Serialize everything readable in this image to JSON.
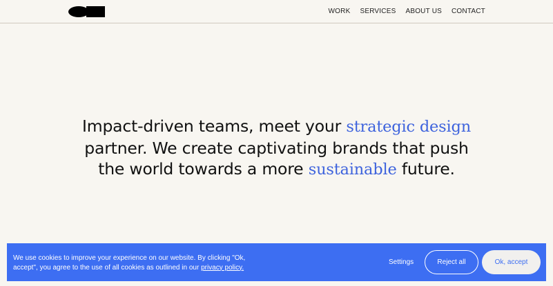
{
  "header": {
    "nav": [
      {
        "label": "WORK"
      },
      {
        "label": "SERVICES"
      },
      {
        "label": "ABOUT US"
      },
      {
        "label": "CONTACT"
      }
    ]
  },
  "hero": {
    "line1_pre": "Impact-driven teams, meet your ",
    "line1_accent": "strategic design",
    "line2": "partner. We create captivating brands that push",
    "line3_pre": "the world towards a more ",
    "line3_accent": "sustainable",
    "line3_post": " future.",
    "accent_color": "#3e63dd"
  },
  "cookie_banner": {
    "text": "We use cookies to improve your experience on our website. By clicking \"Ok, accept\", you agree to the use of all cookies as outlined in our ",
    "link_label": "privacy policy.",
    "settings_label": "Settings",
    "reject_label": "Reject all",
    "accept_label": "Ok, accept",
    "background_color": "#3d6ef2"
  }
}
